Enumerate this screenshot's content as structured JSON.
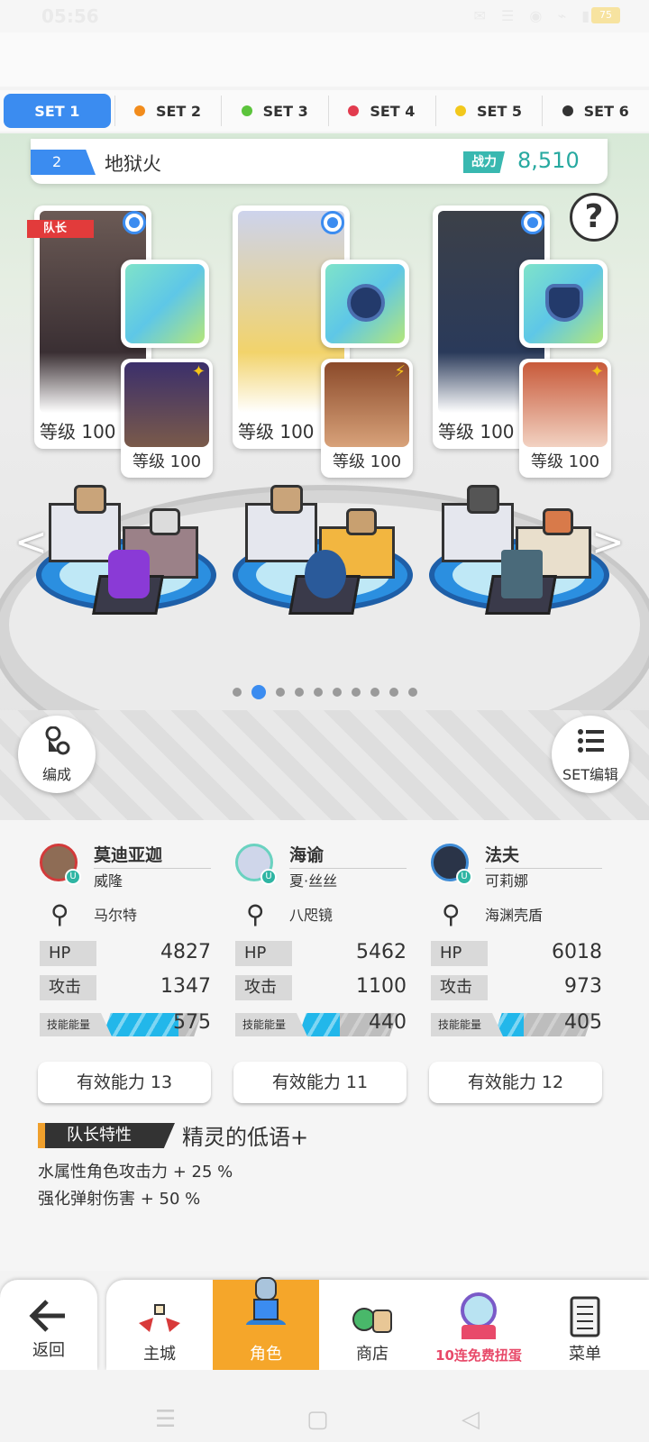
{
  "status": {
    "time": "05:56",
    "battery": "75"
  },
  "tabs": [
    {
      "label": "SET 1",
      "dot": ""
    },
    {
      "label": "SET 2",
      "dot": "#f28c1c"
    },
    {
      "label": "SET 3",
      "dot": "#5cc43c"
    },
    {
      "label": "SET 4",
      "dot": "#e23b4e"
    },
    {
      "label": "SET 5",
      "dot": "#f2c81c"
    },
    {
      "label": "SET 6",
      "dot": "#333333"
    }
  ],
  "team": {
    "number": "2",
    "name": "地狱火",
    "power_label": "战力",
    "power": "8,510"
  },
  "help_label": "?",
  "leader_tag": "队长",
  "heroes": [
    {
      "level": "等级 100",
      "sub_level": "等级 100",
      "color": "#5a4a48"
    },
    {
      "level": "等级 100",
      "sub_level": "等级 100",
      "color": "#d6c9ea"
    },
    {
      "level": "等级 100",
      "sub_level": "等级 100",
      "color": "#3c4048"
    }
  ],
  "page_dots": {
    "count": 10,
    "active": 1
  },
  "buttons": {
    "formation": "编成",
    "set_edit": "SET编辑"
  },
  "columns": [
    {
      "hero": "莫迪亚迦",
      "sub": "威隆",
      "weapon": "马尔特",
      "hp_label": "HP",
      "hp": "4827",
      "atk_label": "攻击",
      "atk": "1347",
      "energy_label": "技能能量",
      "energy": "575",
      "energy_pct": 0.76,
      "effective": "有效能力 13",
      "avatar_color": "#8e6c55",
      "ring": "#d23a3a"
    },
    {
      "hero": "海谕",
      "sub": "夏·丝丝",
      "weapon": "八咫镜",
      "hp_label": "HP",
      "hp": "5462",
      "atk_label": "攻击",
      "atk": "1100",
      "energy_label": "技能能量",
      "energy": "440",
      "energy_pct": 0.42,
      "effective": "有效能力 11",
      "avatar_color": "#cfd6ea",
      "ring": "#6ad2c0"
    },
    {
      "hero": "法夫",
      "sub": "可莉娜",
      "weapon": "海渊壳盾",
      "hp_label": "HP",
      "hp": "6018",
      "atk_label": "攻击",
      "atk": "973",
      "energy_label": "技能能量",
      "energy": "405",
      "energy_pct": 0.3,
      "effective": "有效能力 12",
      "avatar_color": "#2a3448",
      "ring": "#3e8bd6"
    }
  ],
  "leader": {
    "tag": "队长特性",
    "title": "精灵的低语+",
    "effect1": "水属性角色攻击力 + 25 %",
    "effect2": "强化弹射伤害 + 50 %"
  },
  "nav": [
    {
      "label": "返回"
    },
    {
      "label": "主城"
    },
    {
      "label": "角色"
    },
    {
      "label": "商店"
    },
    {
      "label": "10连免费扭蛋"
    },
    {
      "label": "菜单"
    }
  ]
}
